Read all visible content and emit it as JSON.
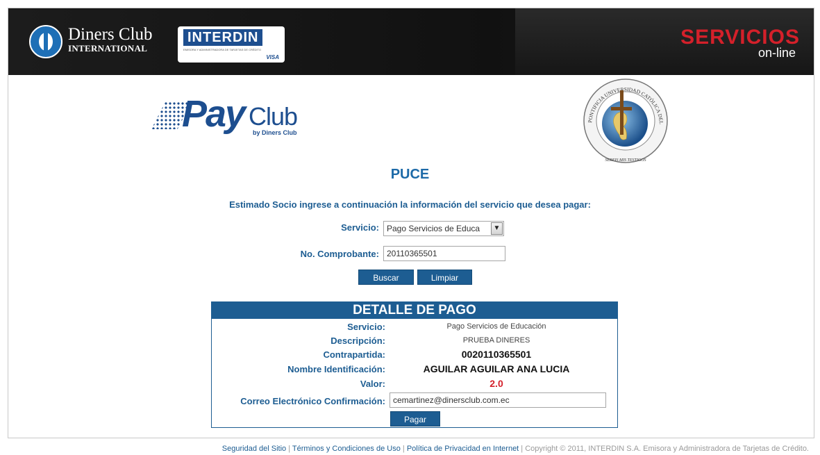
{
  "header": {
    "diners_line1": "Diners Club",
    "diners_line2": "INTERNATIONAL",
    "interdin": "INTERDIN",
    "interdin_sub": "EMISORA Y ADMINISTRADORA DE TARJETAS DE CRÉDITO",
    "interdin_visa": "VISA",
    "servicios": "SERVICIOS",
    "online": "on-line"
  },
  "payclub": {
    "pay": "Pay",
    "club": "Club",
    "by": "by Diners Club"
  },
  "seal": {
    "ring_text": "PONTIFICIA UNIVERSIDAD CATÓLICA DEL ECUADOR",
    "motto": "SEREIS MIS TESTIGOS"
  },
  "main": {
    "title": "PUCE",
    "instruction": "Estimado Socio ingrese a continuación la información del servicio que desea pagar:"
  },
  "form": {
    "servicio_label": "Servicio:",
    "servicio_value": "Pago Servicios de Educa",
    "comprobante_label": "No. Comprobante:",
    "comprobante_value": "20110365501",
    "buscar": "Buscar",
    "limpiar": "Limpiar"
  },
  "detail": {
    "title": "DETALLE DE PAGO",
    "rows": [
      {
        "label": "Servicio:",
        "value": "Pago Servicios de Educación"
      },
      {
        "label": "Descripción:",
        "value": "PRUEBA DINERES"
      },
      {
        "label": "Contrapartida:",
        "value": "0020110365501"
      },
      {
        "label": "Nombre Identificación:",
        "value": "AGUILAR AGUILAR ANA LUCIA"
      },
      {
        "label": "Valor:",
        "value": "2.0"
      }
    ],
    "email_label": "Correo Electrónico Confirmación:",
    "email_value": "cemartinez@dinersclub.com.ec",
    "pagar": "Pagar"
  },
  "footer": {
    "link1": "Seguridad del Sitio",
    "sep": " | ",
    "link2": "Términos y Condiciones de Uso",
    "link3": "Política de Privacidad en Internet",
    "copyright": "Copyright © 2011, INTERDIN S.A. Emisora y Administradora de Tarjetas de Crédito."
  },
  "colors": {
    "brand_blue": "#1d5d92",
    "accent_red": "#d4202a",
    "header_bg": "#161616"
  }
}
